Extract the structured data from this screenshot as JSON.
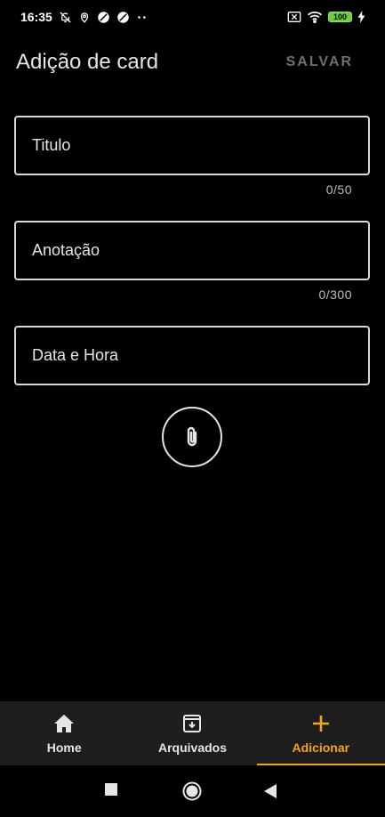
{
  "status_bar": {
    "time": "16:35",
    "battery": "100",
    "icons_left": [
      "notifications-off-icon",
      "location-icon",
      "circle-slash-icon",
      "circle-slash-icon",
      "more-dots-icon"
    ],
    "icons_right": [
      "sim-off-icon",
      "wifi-icon",
      "battery-icon",
      "charging-icon"
    ]
  },
  "header": {
    "title": "Adição de card",
    "save_label": "SALVAR"
  },
  "form": {
    "title_placeholder": "Titulo",
    "title_counter": "0/50",
    "note_placeholder": "Anotação",
    "note_counter": "0/300",
    "datetime_placeholder": "Data e Hora",
    "attach_icon": "paperclip-icon"
  },
  "bottom_nav": {
    "items": [
      {
        "label": "Home",
        "icon": "home-icon",
        "active": false
      },
      {
        "label": "Arquivados",
        "icon": "archive-icon",
        "active": false
      },
      {
        "label": "Adicionar",
        "icon": "plus-icon",
        "active": true
      }
    ]
  },
  "colors": {
    "background": "#000000",
    "accent": "#f5a21d",
    "nav_background": "#1e1e1e",
    "disabled_text": "#707070"
  }
}
